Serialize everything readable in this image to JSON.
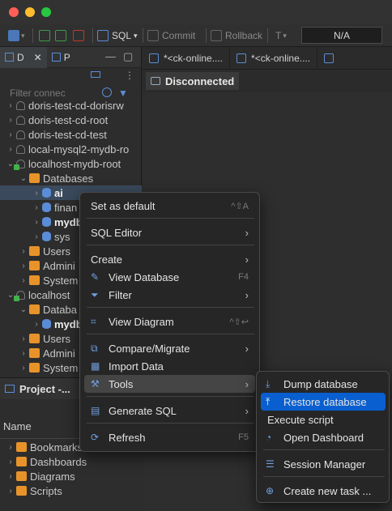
{
  "toolbar": {
    "sql_label": "SQL",
    "commit_label": "Commit",
    "rollback_label": "Rollback",
    "na_value": "N/A"
  },
  "left_tabs": {
    "tab1": "D",
    "tab2": "P"
  },
  "filter": {
    "placeholder": "Filter connec"
  },
  "tree": [
    {
      "label": "doris-test-cd-dorisrw",
      "indent": 0,
      "chev": "›",
      "icon": "conn"
    },
    {
      "label": "doris-test-cd-root",
      "indent": 0,
      "chev": "›",
      "icon": "conn"
    },
    {
      "label": "doris-test-cd-test",
      "indent": 0,
      "chev": "›",
      "icon": "conn"
    },
    {
      "label": "local-mysql2-mydb-ro",
      "indent": 0,
      "chev": "›",
      "icon": "conn"
    },
    {
      "label": "localhost-mydb-root",
      "indent": 0,
      "chev": "⌄",
      "icon": "conn-ok"
    },
    {
      "label": "Databases",
      "indent": 1,
      "chev": "⌄",
      "icon": "folder"
    },
    {
      "label": "ai",
      "indent": 2,
      "chev": "›",
      "icon": "db",
      "selected": true,
      "bold": true
    },
    {
      "label": "finan",
      "indent": 2,
      "chev": "›",
      "icon": "db"
    },
    {
      "label": "mydb",
      "indent": 2,
      "chev": "›",
      "icon": "db",
      "bold": true
    },
    {
      "label": "sys",
      "indent": 2,
      "chev": "›",
      "icon": "db"
    },
    {
      "label": "Users",
      "indent": 1,
      "chev": "›",
      "icon": "user"
    },
    {
      "label": "Admini",
      "indent": 1,
      "chev": "›",
      "icon": "admin"
    },
    {
      "label": "System",
      "indent": 1,
      "chev": "›",
      "icon": "sys"
    },
    {
      "label": "localhost",
      "indent": 0,
      "chev": "⌄",
      "icon": "conn-ok"
    },
    {
      "label": "Databa",
      "indent": 1,
      "chev": "⌄",
      "icon": "folder"
    },
    {
      "label": "mydb",
      "indent": 2,
      "chev": "›",
      "icon": "db",
      "bold": true
    },
    {
      "label": "Users",
      "indent": 1,
      "chev": "›",
      "icon": "user"
    },
    {
      "label": "Admini",
      "indent": 1,
      "chev": "›",
      "icon": "admin"
    },
    {
      "label": "System",
      "indent": 1,
      "chev": "›",
      "icon": "sys"
    }
  ],
  "project_panel": {
    "title": "Project -...",
    "column_name": "Name",
    "items": [
      "Bookmarks",
      "Dashboards",
      "Diagrams",
      "Scripts"
    ]
  },
  "editor_tabs": [
    "*<ck-online....",
    "*<ck-online....",
    ""
  ],
  "connection_status": "Disconnected",
  "context_menu": {
    "items": [
      {
        "label": "Set as default",
        "shortcut": "^⇧A",
        "arrow": false,
        "icon": ""
      },
      {
        "label": "SQL Editor",
        "shortcut": "",
        "arrow": true,
        "icon": ""
      },
      {
        "label": "Create",
        "shortcut": "",
        "arrow": true,
        "icon": ""
      },
      {
        "label": "View Database",
        "shortcut": "F4",
        "arrow": false,
        "icon": "pencil"
      },
      {
        "label": "Filter",
        "shortcut": "",
        "arrow": true,
        "icon": "filter"
      },
      {
        "label": "View Diagram",
        "shortcut": "^⇧↩",
        "arrow": false,
        "icon": "diagram"
      },
      {
        "label": "Compare/Migrate",
        "shortcut": "",
        "arrow": true,
        "icon": "compare"
      },
      {
        "label": "Import Data",
        "shortcut": "",
        "arrow": false,
        "icon": "table"
      },
      {
        "label": "Tools",
        "shortcut": "",
        "arrow": true,
        "icon": "tools",
        "highlighted": true
      },
      {
        "label": "Generate SQL",
        "shortcut": "",
        "arrow": true,
        "icon": "sql"
      },
      {
        "label": "Refresh",
        "shortcut": "F5",
        "arrow": false,
        "icon": "refresh"
      }
    ]
  },
  "tools_submenu": {
    "items": [
      {
        "label": "Dump database",
        "icon": "dump"
      },
      {
        "label": "Restore database",
        "icon": "restore",
        "highlighted": true
      },
      {
        "label": "Execute script",
        "icon": ""
      },
      {
        "label": "Open Dashboard",
        "icon": "dashboard"
      },
      {
        "label": "Session Manager",
        "icon": "session"
      },
      {
        "label": "Create new task ...",
        "icon": "task"
      }
    ]
  },
  "colors": {
    "accent": "#0a5fd0",
    "menu_bg": "#262626",
    "panel_bg": "#2d2d2d"
  }
}
